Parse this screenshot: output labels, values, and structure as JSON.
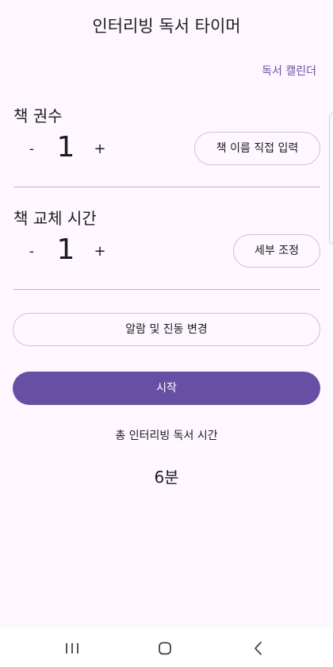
{
  "app": {
    "title": "인터리빙 독서 타이머",
    "calendar_link": "독서 캘린더"
  },
  "books": {
    "label": "책 권수",
    "minus": "-",
    "value": "1",
    "plus": "+",
    "name_button": "책 이름 직접 입력"
  },
  "switch_time": {
    "label": "책 교체 시간",
    "minus": "-",
    "value": "1",
    "plus": "+",
    "detail_button": "세부 조정"
  },
  "alarm_button": "알람 및 진동 변경",
  "start_button": "시작",
  "total": {
    "label": "총 인터리빙 독서 시간",
    "value": "6분"
  },
  "nav_bar": {
    "recents_icon": "recents-icon",
    "home_icon": "home-icon",
    "back_icon": "back-icon"
  },
  "colors": {
    "background": "#fef7ff",
    "accent": "#6750a4",
    "outline": "#cac4cf",
    "text": "#1d1b20"
  }
}
